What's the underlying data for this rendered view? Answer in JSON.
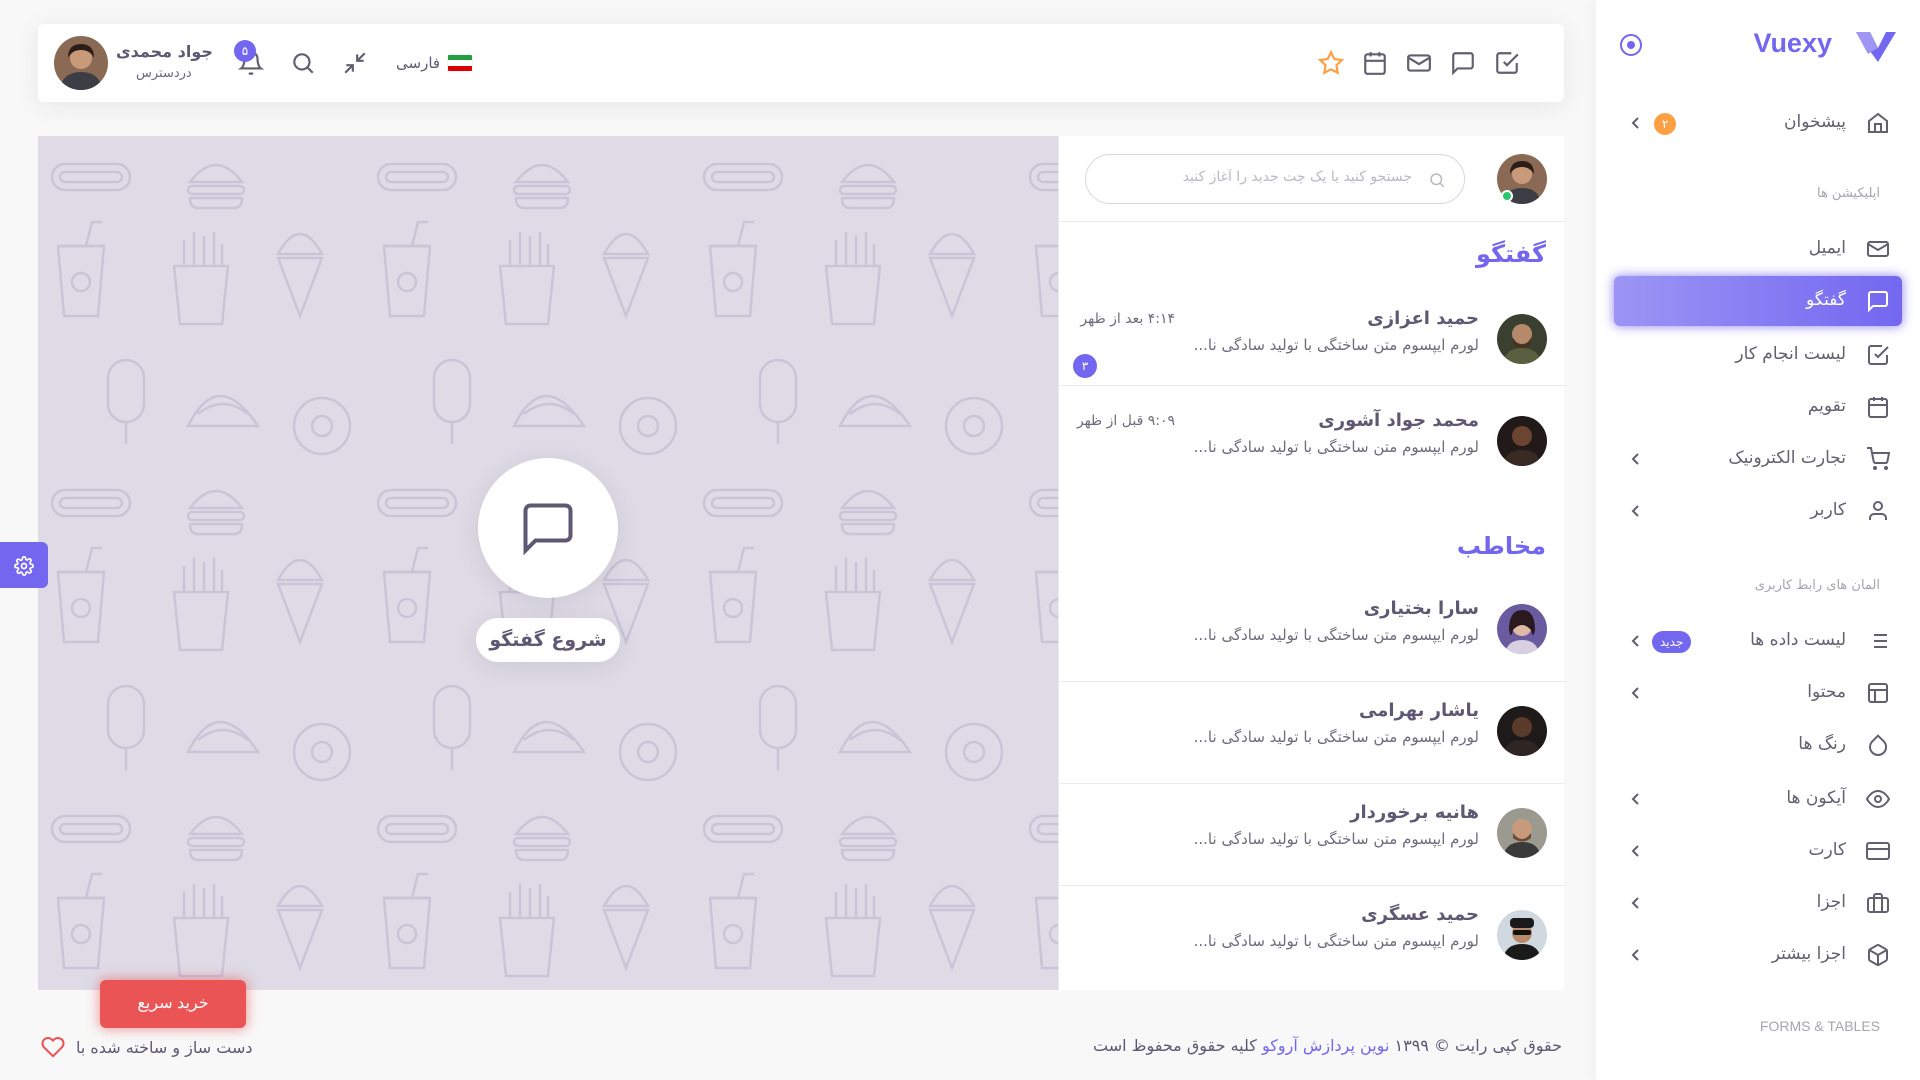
{
  "brand": {
    "name": "Vuexy"
  },
  "sidebar": {
    "items": [
      {
        "label": "پیشخوان",
        "badge": "۲",
        "badge_color": "#ff9f43"
      },
      {
        "section": "اپلیکیشن ها"
      },
      {
        "label": "ایمیل"
      },
      {
        "label": "گفتگو",
        "active": true
      },
      {
        "label": "لیست انجام کار"
      },
      {
        "label": "تقویم"
      },
      {
        "label": "تجارت الکترونیک"
      },
      {
        "label": "کاربر"
      },
      {
        "section": "المان های رابط کاربری"
      },
      {
        "label": "لیست داده ها",
        "badge": "جدید",
        "badge_color": "#7367f0"
      },
      {
        "label": "محتوا"
      },
      {
        "label": "رنگ ها"
      },
      {
        "label": "آیکون ها"
      },
      {
        "label": "کارت"
      },
      {
        "label": "اجزا"
      },
      {
        "label": "اجزا بیشتر"
      },
      {
        "section": "FORMS & TABLES"
      }
    ]
  },
  "header": {
    "user_name": "جواد محمدی",
    "user_status": "دردسترس",
    "notifications_count": "۵",
    "language": "فارسی"
  },
  "chat": {
    "search_placeholder": "جستجو کنید یا یک چت جدید را آغاز کنید",
    "chats_title": "گفتگو",
    "contacts_title": "مخاطب",
    "chats": [
      {
        "name": "حمید اعزازی",
        "message": "لورم ایپسوم متن ساختگی با تولید سادگی نا...",
        "time": "۴:۱۴ بعد از ظهر",
        "unread": "۳"
      },
      {
        "name": "محمد جواد آشوری",
        "message": "لورم ایپسوم متن ساختگی با تولید سادگی نا...",
        "time": "۹:۰۹ قبل از ظهر"
      }
    ],
    "contacts": [
      {
        "name": "سارا بختیاری",
        "message": "لورم ایپسوم متن ساختگی با تولید سادگی نا..."
      },
      {
        "name": "یاشار بهرامی",
        "message": "لورم ایپسوم متن ساختگی با تولید سادگی نا..."
      },
      {
        "name": "هانیه برخوردار",
        "message": "لورم ایپسوم متن ساختگی با تولید سادگی نا..."
      },
      {
        "name": "حمید عسگری",
        "message": "لورم ایپسوم متن ساختگی با تولید سادگی نا..."
      }
    ],
    "start_label": "شروع گفتگو"
  },
  "buy_now": "خرید سریع",
  "footer": {
    "made_with": "دست ساز و ساخته شده با",
    "copyright_prefix": "حقوق کپی رایت © ۱۳۹۹",
    "copyright_link": "نوین پردازش آروکو",
    "copyright_suffix": "کلیه حقوق محفوظ است"
  },
  "colors": {
    "primary": "#7367f0",
    "warning": "#ff9f43",
    "danger": "#ea5455",
    "success": "#28c76f",
    "chat_bg": "#dedbe6"
  }
}
